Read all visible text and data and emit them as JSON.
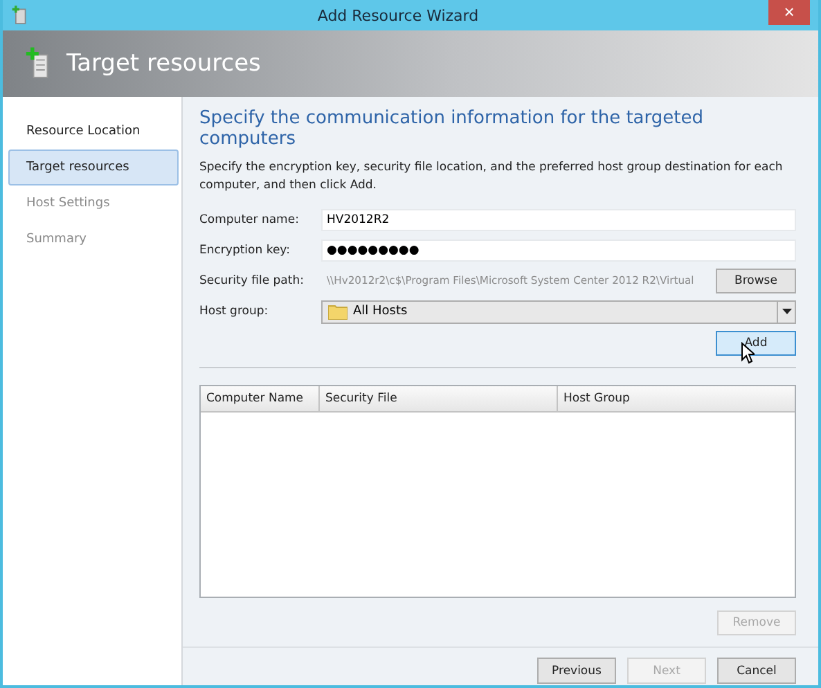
{
  "window": {
    "title": "Add Resource Wizard",
    "close": "×"
  },
  "header": {
    "title": "Target resources"
  },
  "steps": [
    {
      "label": "Resource Location",
      "selected": false,
      "disabled": false
    },
    {
      "label": "Target resources",
      "selected": true,
      "disabled": false
    },
    {
      "label": "Host Settings",
      "selected": false,
      "disabled": true
    },
    {
      "label": "Summary",
      "selected": false,
      "disabled": true
    }
  ],
  "heading": "Specify the communication information for the targeted computers",
  "description": "Specify the encryption key, security file location, and the preferred host group destination for each computer, and then click Add.",
  "fields": [
    {
      "kind": "text",
      "label": "Computer name:",
      "value": "HV2012R2",
      "disabled": false
    },
    {
      "kind": "text",
      "label": "Encryption key:",
      "value": "●●●●●●●●●",
      "disabled": false
    },
    {
      "kind": "browse",
      "label": "Security file path:",
      "value": "\\\\Hv2012r2\\c$\\Program Files\\Microsoft System Center 2012 R2\\Virtual",
      "disabled": true,
      "button": "Browse"
    },
    {
      "kind": "dropdown",
      "label": "Host group:",
      "value": "All Hosts",
      "disabled": false
    }
  ],
  "add_button": {
    "label": "Add",
    "highlighted": true
  },
  "table": {
    "columns": [
      "Computer Name",
      "Security File",
      "Host Group"
    ]
  },
  "remove_button": {
    "label": "Remove",
    "disabled": true
  },
  "footer_buttons": [
    {
      "label": "Previous",
      "disabled": false
    },
    {
      "label": "Next",
      "disabled": true
    },
    {
      "label": "Cancel",
      "disabled": false
    }
  ]
}
